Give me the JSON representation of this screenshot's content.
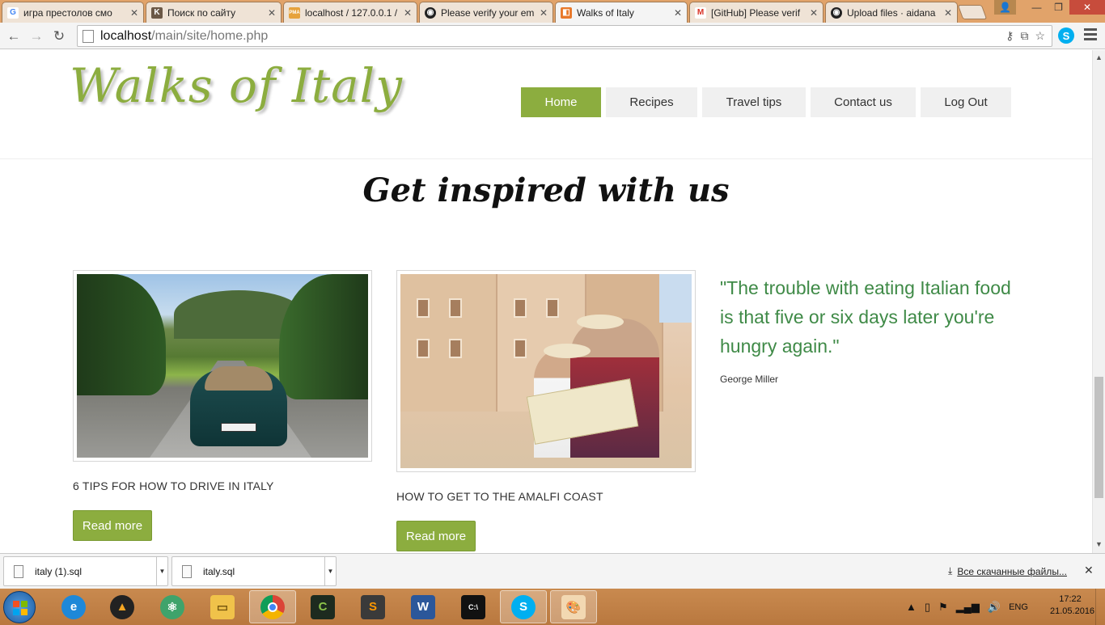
{
  "browser": {
    "tabs": [
      {
        "title": "игра престолов смо",
        "icon": "google-g",
        "color": "#4285f4",
        "glyph": "G"
      },
      {
        "title": "Поиск по сайту",
        "icon": "k-site",
        "color": "#6b5846",
        "glyph": "K"
      },
      {
        "title": "localhost / 127.0.0.1 /",
        "icon": "phpmyadmin",
        "color": "#e6a23c",
        "glyph": "PMA"
      },
      {
        "title": "Please verify your em",
        "icon": "github-octocat",
        "color": "#222222",
        "glyph": "◉"
      },
      {
        "title": "Walks of Italy",
        "icon": "html5-tab",
        "color": "#e8792b",
        "glyph": "◧",
        "active": true
      },
      {
        "title": "[GitHub] Please verif",
        "icon": "gmail-m",
        "color": "#d93025",
        "glyph": "M"
      },
      {
        "title": "Upload files · aidana",
        "icon": "github-octocat",
        "color": "#222222",
        "glyph": "◉"
      }
    ],
    "url_host": "localhost",
    "url_path": "/main/site/home.php"
  },
  "site": {
    "logo": "Walks of Italy",
    "nav": [
      {
        "label": "Home",
        "active": true
      },
      {
        "label": "Recipes"
      },
      {
        "label": "Travel tips"
      },
      {
        "label": "Contact us"
      },
      {
        "label": "Log Out"
      }
    ],
    "section_title": "Get inspired with us",
    "cards": [
      {
        "title": "6 TIPS FOR HOW TO DRIVE IN ITALY",
        "button": "Read more"
      },
      {
        "title": "HOW TO GET TO THE AMALFI COAST",
        "button": "Read more"
      }
    ],
    "quote": {
      "text": "\"The trouble with eating Italian food is that five or six days later you're hungry again.\"",
      "author": "George Miller"
    },
    "colors": {
      "accent": "#8cad3f",
      "quote": "#3f8a47"
    }
  },
  "downloads": {
    "items": [
      "italy (1).sql",
      "italy.sql"
    ],
    "all_label": "Все скачанные файлы..."
  },
  "taskbar": {
    "apps": [
      "internet-explorer",
      "aimp",
      "atom",
      "file-explorer",
      "chrome",
      "eclipse",
      "sublime-text",
      "word",
      "cmd",
      "skype",
      "paint"
    ],
    "language": "ENG",
    "time": "17:22",
    "date": "21.05.2016"
  }
}
